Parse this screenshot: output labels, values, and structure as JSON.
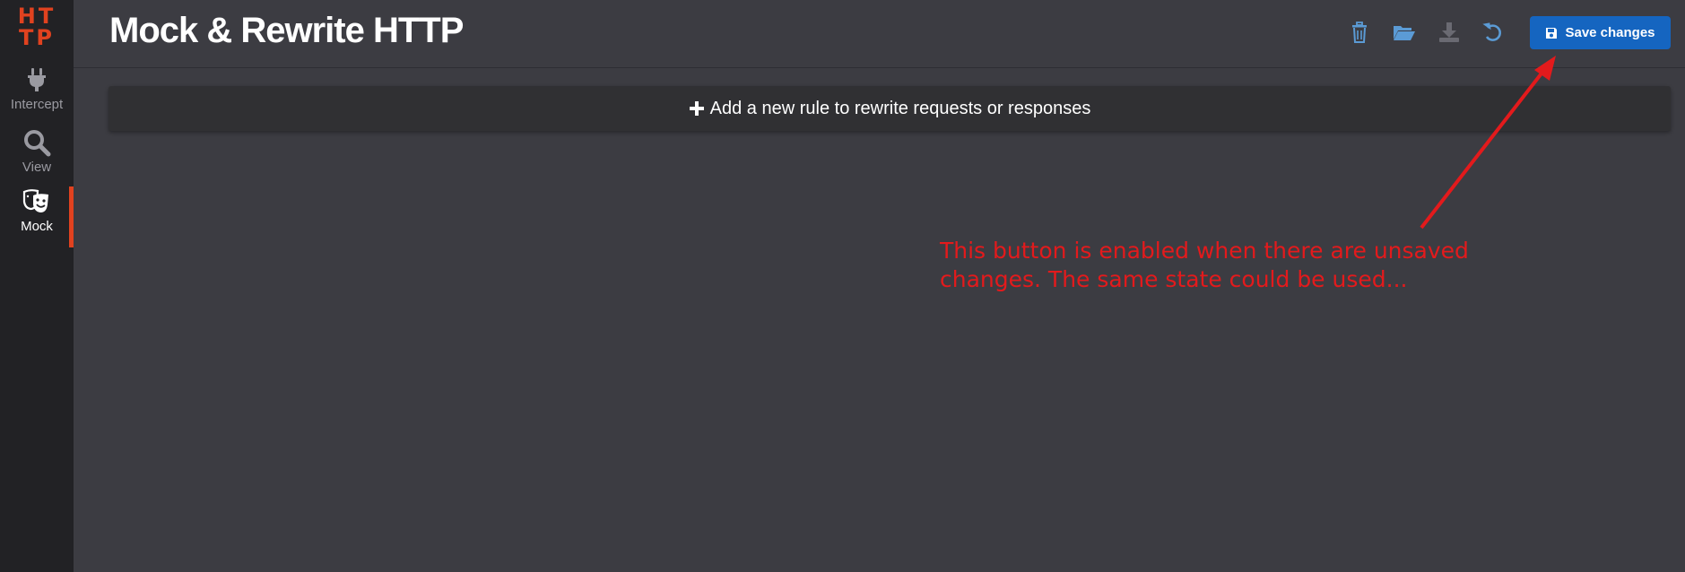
{
  "sidebar": {
    "logo": [
      "HT",
      "TP"
    ],
    "items": [
      {
        "label": "Intercept",
        "icon": "plug-icon",
        "active": false
      },
      {
        "label": "View",
        "icon": "search-icon",
        "active": false
      },
      {
        "label": "Mock",
        "icon": "theater-masks-icon",
        "active": true
      }
    ]
  },
  "header": {
    "title": "Mock & Rewrite HTTP",
    "toolbar": {
      "delete_icon": "trash-icon",
      "open_icon": "folder-open-icon",
      "download_icon": "download-icon",
      "reset_icon": "undo-icon",
      "save_label": "Save changes"
    }
  },
  "main": {
    "add_rule_label": "Add a new rule to rewrite requests or responses"
  },
  "annotation": {
    "text": "This button is enabled when there are unsaved\nchanges. The same state could be used..."
  },
  "colors": {
    "accent": "#e1421f",
    "primary_button": "#1565c0",
    "toolbar_icon": "#5b9bd5",
    "annotation": "#e31a1c"
  }
}
